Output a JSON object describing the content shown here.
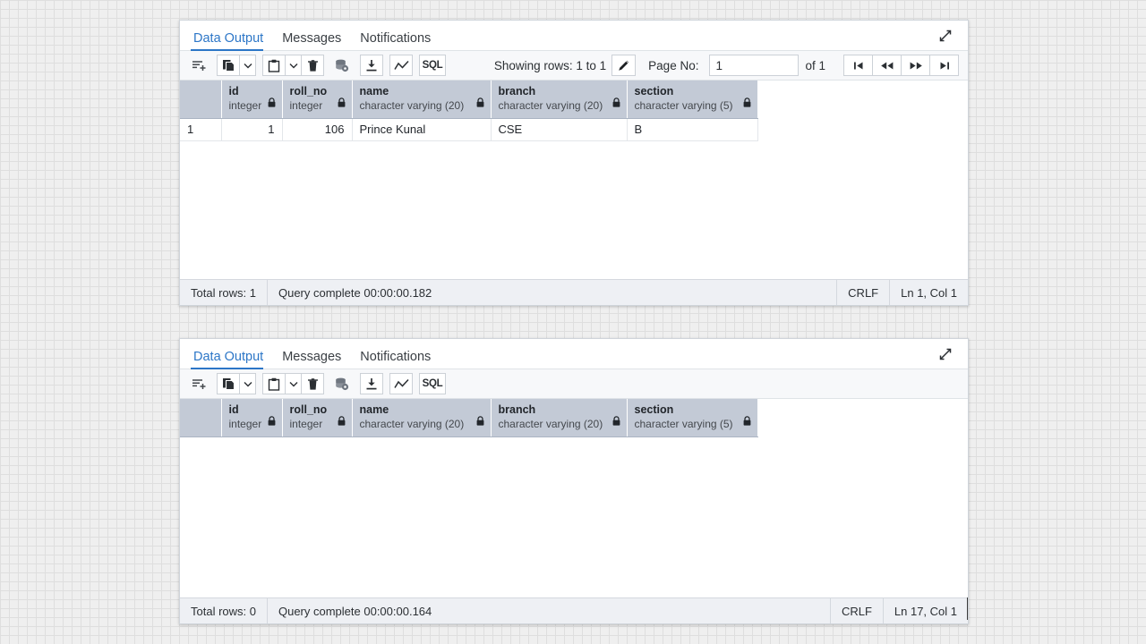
{
  "panels": [
    {
      "tabs": [
        {
          "label": "Data Output",
          "active": true
        },
        {
          "label": "Messages",
          "active": false
        },
        {
          "label": "Notifications",
          "active": false
        }
      ],
      "toolbar": {
        "showing_rows_label": "Showing rows: 1 to 1",
        "page_no_label": "Page No:",
        "page_no_value": "1",
        "of_label": "of 1",
        "icons": [
          "add-row-icon",
          "copy-icon",
          "copy-dropdown-caret-icon",
          "paste-icon",
          "paste-dropdown-caret-icon",
          "delete-icon",
          "save-data-changes-icon",
          "download-icon",
          "graph-visualiser-icon",
          "sql-icon"
        ],
        "sql_label": "SQL",
        "nav": [
          "first-page-icon",
          "previous-page-icon",
          "next-page-icon",
          "last-page-icon"
        ]
      },
      "columns": [
        {
          "name": "id",
          "type": "integer",
          "locked": true
        },
        {
          "name": "roll_no",
          "type": "integer",
          "locked": true
        },
        {
          "name": "name",
          "type": "character varying (20)",
          "locked": true
        },
        {
          "name": "branch",
          "type": "character varying (20)",
          "locked": true
        },
        {
          "name": "section",
          "type": "character varying (5)",
          "locked": true
        }
      ],
      "rows": [
        {
          "n": "1",
          "cells": [
            "1",
            "106",
            "Prince Kunal",
            "CSE",
            "B"
          ]
        }
      ],
      "status": {
        "total_rows": "Total rows: 1",
        "query_status": "Query complete 00:00:00.182",
        "line_ending": "CRLF",
        "cursor": "Ln 1, Col 1"
      }
    },
    {
      "tabs": [
        {
          "label": "Data Output",
          "active": true
        },
        {
          "label": "Messages",
          "active": false
        },
        {
          "label": "Notifications",
          "active": false
        }
      ],
      "toolbar": {
        "showing_rows_label": "",
        "page_no_label": "",
        "page_no_value": "",
        "of_label": "",
        "icons": [
          "add-row-icon",
          "copy-icon",
          "copy-dropdown-caret-icon",
          "paste-icon",
          "paste-dropdown-caret-icon",
          "delete-icon",
          "save-data-changes-icon",
          "download-icon",
          "graph-visualiser-icon",
          "sql-icon"
        ],
        "sql_label": "SQL",
        "nav": []
      },
      "columns": [
        {
          "name": "id",
          "type": "integer",
          "locked": true
        },
        {
          "name": "roll_no",
          "type": "integer",
          "locked": true
        },
        {
          "name": "name",
          "type": "character varying (20)",
          "locked": true
        },
        {
          "name": "branch",
          "type": "character varying (20)",
          "locked": true
        },
        {
          "name": "section",
          "type": "character varying (5)",
          "locked": true
        }
      ],
      "rows": [],
      "status": {
        "total_rows": "Total rows: 0",
        "query_status": "Query complete 00:00:00.164",
        "line_ending": "CRLF",
        "cursor": "Ln 17, Col 1"
      }
    }
  ],
  "colors": {
    "accent": "#2c76c7",
    "header_bg": "#c3cad6",
    "panel_bg": "#ffffff",
    "status_bg": "#eef0f4",
    "page_bg": "#efefef"
  }
}
